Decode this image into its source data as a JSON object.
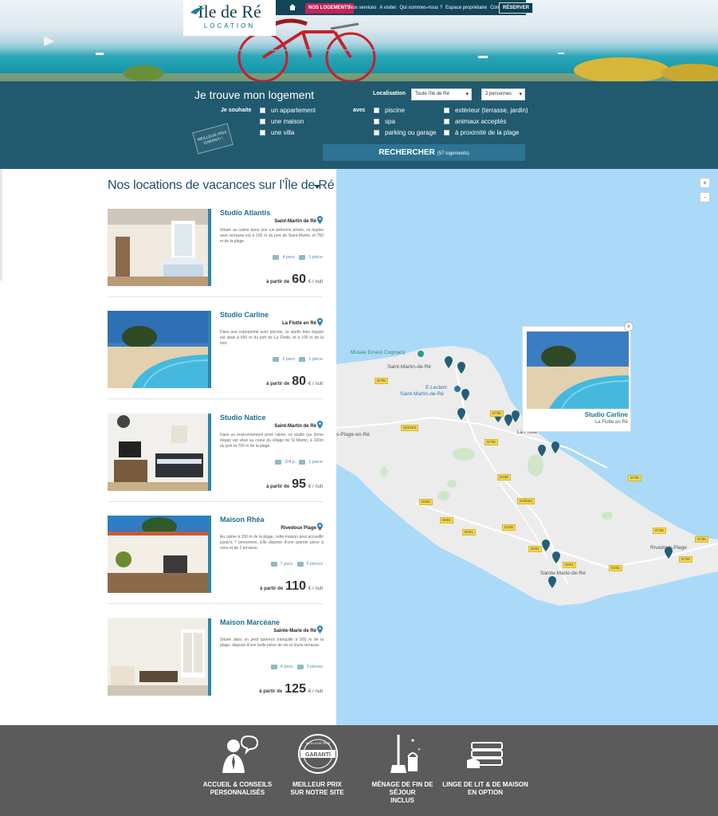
{
  "header": {
    "logo_main": "Ile de Ré",
    "logo_sub": "LOCATION",
    "nav_active": "NOS LOGEMENTS",
    "nav_links": [
      "Nos services",
      "A visiter",
      "Qui sommes-nous ?",
      "Espace propriétaire",
      "Contact"
    ],
    "nav_reserve": "RÉSERVER"
  },
  "search": {
    "title": "Je trouve mon logement",
    "localisation_label": "Localisation",
    "localisation_value": "Toute l'île de Ré",
    "personnes_value": "2 personnes",
    "souhaite_label": "Je souhaite",
    "avec_label": "avec",
    "types": [
      "un appartement",
      "une maison",
      "une villa"
    ],
    "amenities_col1": [
      "piscine",
      "spa",
      "parking ou garage"
    ],
    "amenities_col2": [
      "extérieur (terrasse, jardin)",
      "animaux acceptés",
      "à proximité de la plage"
    ],
    "badge_line1": "MEILLEUR PRIX",
    "badge_line2": "GARANTI !",
    "button_label": "RECHERCHER",
    "button_count": "(57 logements)"
  },
  "listing": {
    "title": "Nos locations de vacances sur l’Île de Ré",
    "price_label": "à partir de",
    "price_unit": "€ / nuit",
    "items": [
      {
        "name": "Studio Atlantis",
        "town": "Saint-Martin de Ré",
        "desc": "Située au calme dans une rue piétonne privée, ce duplex avec terrasse est à 100 m du port de Saint-Martin, et 750 m de la plage",
        "pers": "4 pers.",
        "rooms": "1 pièce",
        "price": "60"
      },
      {
        "name": "Studio Carline",
        "town": "La Flotte en Ré",
        "desc": "Dans une copropriété avec piscine, ce studio bien équipé est situé à 500 m du port de La Flotte, et à 100 m de la mer.",
        "pers": "2 pers.",
        "rooms": "1 pièce",
        "price": "80"
      },
      {
        "name": "Studio Natice",
        "town": "Saint-Martin de Ré",
        "desc": "Dans un environnement privé calme, ce studio (au 2ème étage) est situé au coeur du village de St Martin, à 100m du port et 700 m de la plage.",
        "pers": "2/4 p.",
        "rooms": "1 pièce",
        "price": "95"
      },
      {
        "name": "Maison Rhéa",
        "town": "Rivedoux Plage",
        "desc": "Au calme à 150 m de la plage, cette maison peut accueillir jusqu'à 7 personnes. Elle dispose d'une grande pièce à vivre et de 2 terrasse.",
        "pers": "7 pers.",
        "rooms": "5 pièces",
        "price": "110"
      },
      {
        "name": "Maison Marcéane",
        "town": "Sainte-Marie de Ré",
        "desc": "Située dans un petit quéreux tranquille à 500 m de la plage, dispose d'une belle pièce de vie et d'une terrasse.",
        "pers": "4 pers.",
        "rooms": "3 pièces",
        "price": "125"
      }
    ]
  },
  "map": {
    "labels": {
      "musee": "Musée Ernest Cognacq",
      "stmartin": "Saint-Martin-de-Ré",
      "leclerc_1": "E.Leclerc",
      "leclerc_2": "Saint-Martin-de-Ré",
      "plage": "s-Plage-en-Ré",
      "flotte": "La Flotte",
      "stemarie": "Sainte-Marie-de-Ré",
      "rivedoux": "Rivedoux-Plage"
    },
    "roads": [
      "D735",
      "D201E2",
      "D735",
      "D735",
      "D108",
      "D735",
      "D201E1",
      "D201",
      "D201",
      "D201",
      "D108",
      "D201",
      "D201",
      "D201",
      "D735",
      "D735",
      "D735"
    ],
    "zoom_in": "+",
    "zoom_out": "-",
    "popup": {
      "name": "Studio Carline",
      "town": "La Flotte en Ré",
      "close": "x"
    }
  },
  "footer": {
    "features": [
      {
        "line1": "ACCUEIL & CONSEILS",
        "line2": "PERSONNALISÉS"
      },
      {
        "line1": "MEILLEUR PRIX",
        "line2": "SUR NOTRE SITE"
      },
      {
        "line1": "MÉNAGE DE FIN DE SÉJOUR",
        "line2": "INCLUS"
      },
      {
        "line1": "LINGE DE LIT & DE MAISON",
        "line2": "EN OPTION"
      }
    ],
    "badge_text_1": "MEILLEUR PRIX",
    "badge_text_2": "GARANTI"
  },
  "colors": {
    "brand_dark": "#215a6e",
    "accent_pink": "#c0245a",
    "link_blue": "#1f6f8f",
    "footer_grey": "#5b5b5b",
    "map_water": "#aadaf7"
  }
}
